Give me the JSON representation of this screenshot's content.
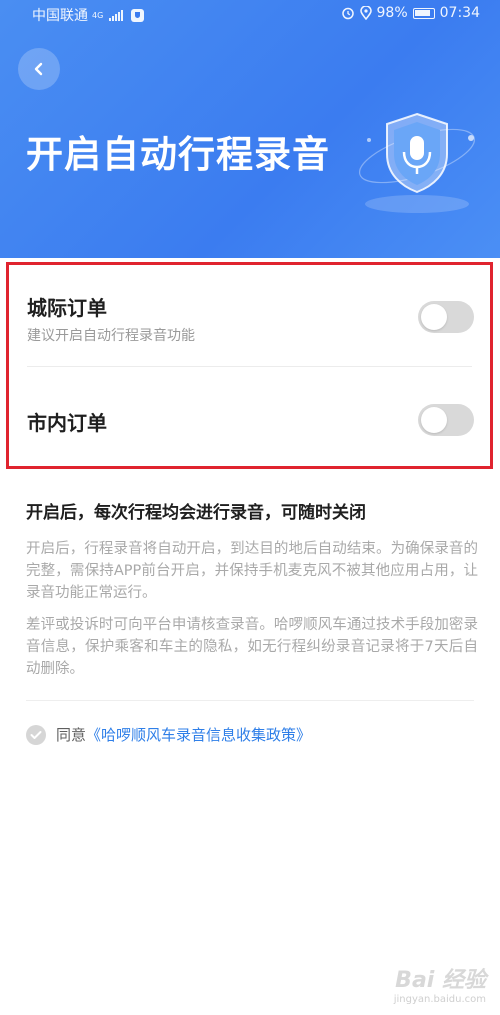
{
  "status_bar": {
    "carrier": "中国联通",
    "network": "4G",
    "battery": "98%",
    "time": "07:34"
  },
  "header": {
    "title": "开启自动行程录音"
  },
  "settings": {
    "intercity": {
      "label": "城际订单",
      "hint": "建议开启自动行程录音功能",
      "enabled": false
    },
    "city": {
      "label": "市内订单",
      "enabled": false
    }
  },
  "info": {
    "title": "开启后，每次行程均会进行录音，可随时关闭",
    "paragraph_1": "开启后，行程录音将自动开启，到达目的地后自动结束。为确保录音的完整，需保持APP前台开启，并保持手机麦克风不被其他应用占用，让录音功能正常运行。",
    "paragraph_2": "差评或投诉时可向平台申请核查录音。哈啰顺风车通过技术手段加密录音信息，保护乘客和车主的隐私，如无行程纠纷录音记录将于7天后自动删除。"
  },
  "agreement": {
    "prefix": "同意",
    "link": "《哈啰顺风车录音信息收集政策》",
    "checked": true
  },
  "watermark": {
    "logo": "Bai 经验",
    "url": "jingyan.baidu.com"
  },
  "colors": {
    "header_blue": "#3b7cf0",
    "highlight_red": "#e0232f",
    "link_blue": "#2f7fe8"
  },
  "icons": {
    "back": "chevron-left-icon",
    "hero": "microphone-shield-icon",
    "check": "check-circle-icon"
  }
}
